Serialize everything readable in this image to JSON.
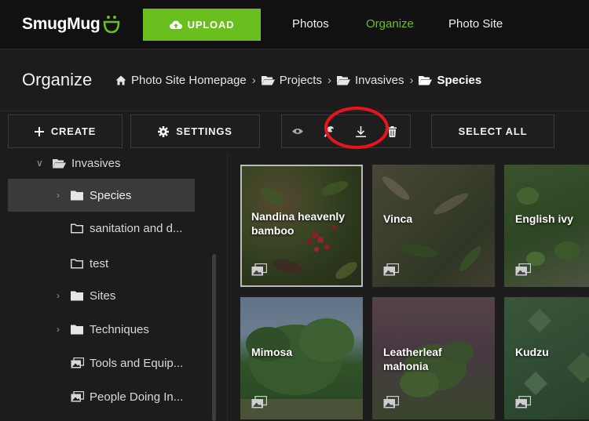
{
  "app": {
    "logo_text": "SmugMug"
  },
  "topnav": {
    "upload_label": "UPLOAD",
    "links": [
      {
        "label": "Photos",
        "active": false
      },
      {
        "label": "Organize",
        "active": true
      },
      {
        "label": "Photo Site",
        "active": false
      }
    ]
  },
  "header": {
    "title": "Organize",
    "breadcrumbs": [
      {
        "label": "Photo Site Homepage",
        "icon": "home-icon"
      },
      {
        "label": "Projects",
        "icon": "folder-open-icon"
      },
      {
        "label": "Invasives",
        "icon": "folder-open-icon"
      },
      {
        "label": "Species",
        "icon": "folder-open-icon"
      }
    ]
  },
  "toolbar": {
    "create_label": "CREATE",
    "settings_label": "SETTINGS",
    "select_all_label": "SELECT ALL",
    "icons": [
      "eye-icon",
      "wrench-icon",
      "download-icon",
      "trash-icon"
    ]
  },
  "sidebar": {
    "items": [
      {
        "label": "Invasives",
        "icon": "folder-open-icon",
        "chevron": "down"
      },
      {
        "label": "Species",
        "icon": "folder-icon",
        "chevron": "right",
        "selected": true
      },
      {
        "label": "sanitation and d...",
        "icon": "folder-outline-icon"
      },
      {
        "label": "test",
        "icon": "folder-outline-icon"
      },
      {
        "label": "Sites",
        "icon": "folder-icon",
        "chevron": "right"
      },
      {
        "label": "Techniques",
        "icon": "folder-icon",
        "chevron": "right"
      },
      {
        "label": "Tools and Equip...",
        "icon": "gallery-icon"
      },
      {
        "label": "People Doing In...",
        "icon": "gallery-icon"
      }
    ]
  },
  "gallery": {
    "tiles": [
      {
        "label": "Nandina heavenly bamboo",
        "selected": true
      },
      {
        "label": "Vinca"
      },
      {
        "label": "English ivy"
      },
      {
        "label": "Mimosa"
      },
      {
        "label": "Leatherleaf mahonia"
      },
      {
        "label": "Kudzu"
      }
    ]
  },
  "colors": {
    "brand_green": "#6abf1e",
    "highlight_red": "#e8141c",
    "background": "#1d1d1d"
  }
}
